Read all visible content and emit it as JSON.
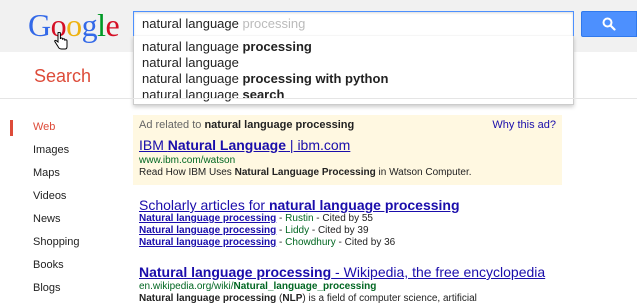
{
  "header": {
    "logo": {
      "letters": [
        "G",
        "o",
        "o",
        "g",
        "l",
        "e"
      ],
      "colors": [
        "#3369e8",
        "#d50f25",
        "#eeb211",
        "#3369e8",
        "#009925",
        "#d50f25"
      ]
    },
    "search": {
      "typed": "natural language",
      "completion": " processing"
    },
    "search_button_icon": "search-icon"
  },
  "suggestions": [
    {
      "prefix": "natural language ",
      "bold": "processing"
    },
    {
      "prefix": "natural language",
      "bold": ""
    },
    {
      "prefix": "natural language ",
      "bold": "processing with python"
    },
    {
      "prefix": "natural language ",
      "bold": "search"
    }
  ],
  "search_label": "Search",
  "sidebar": {
    "items": [
      {
        "label": "Web",
        "active": true
      },
      {
        "label": "Images"
      },
      {
        "label": "Maps"
      },
      {
        "label": "Videos"
      },
      {
        "label": "News"
      },
      {
        "label": "Shopping"
      },
      {
        "label": "Books"
      },
      {
        "label": "Blogs"
      }
    ]
  },
  "ad": {
    "related_prefix": "Ad related to ",
    "related_query": "natural language processing",
    "why": "Why this ad?",
    "title_prefix": "IBM ",
    "title_bold": "Natural Language",
    "title_suffix": " | ibm.com",
    "url": "www.ibm.com/watson",
    "desc_prefix": "Read How IBM Uses ",
    "desc_bold": "Natural Language Processing",
    "desc_suffix": " in Watson Computer."
  },
  "scholar": {
    "title_prefix": "Scholarly articles for ",
    "title_bold": "natural language processing",
    "rows": [
      {
        "link": "Natural language processing",
        "author": "Rustin",
        "cited": "Cited by 55"
      },
      {
        "link": "Natural language processing",
        "author": "Liddy",
        "cited": "Cited by 39"
      },
      {
        "link": "Natural language processing",
        "author": "Chowdhury",
        "cited": "Cited by 36"
      }
    ]
  },
  "wiki": {
    "title_bold": "Natural language processing",
    "title_suffix": " - Wikipedia, the free encyclopedia",
    "url_prefix": "en.wikipedia.org/wiki/",
    "url_bold": "Natural_language_processing",
    "desc_bold": "Natural language processing",
    "desc_mid": " (",
    "desc_bold2": "NLP",
    "desc_suffix": ") is a field of computer science, artificial"
  }
}
